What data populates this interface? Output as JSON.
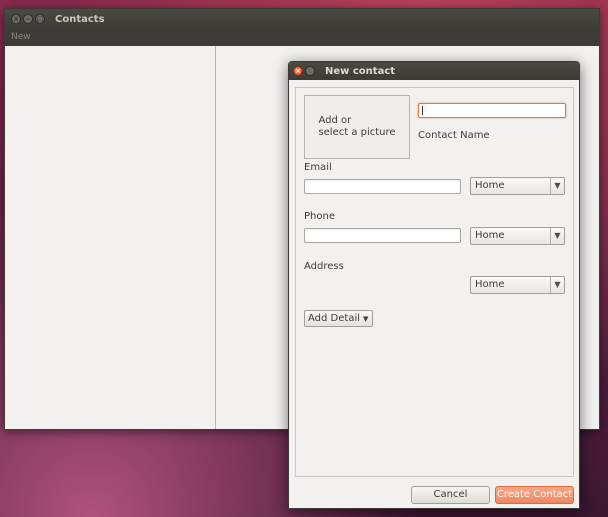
{
  "main_window": {
    "title": "Contacts",
    "menu": {
      "new_label": "New"
    }
  },
  "dialog": {
    "title": "New contact",
    "picture": {
      "line1": "Add or",
      "line2": "select a picture"
    },
    "contact_name": {
      "value": "",
      "label": "Contact Name"
    },
    "email": {
      "label": "Email",
      "value": "",
      "type": "Home"
    },
    "phone": {
      "label": "Phone",
      "value": "",
      "type": "Home"
    },
    "address": {
      "label": "Address",
      "type": "Home"
    },
    "add_detail_label": "Add Detail",
    "cancel_label": "Cancel",
    "create_label": "Create Contact"
  },
  "colors": {
    "accent": "#ef8761",
    "focus_border": "#e3753f",
    "titlebar": "#3c3b37",
    "window_bg": "#f2f1f0"
  }
}
